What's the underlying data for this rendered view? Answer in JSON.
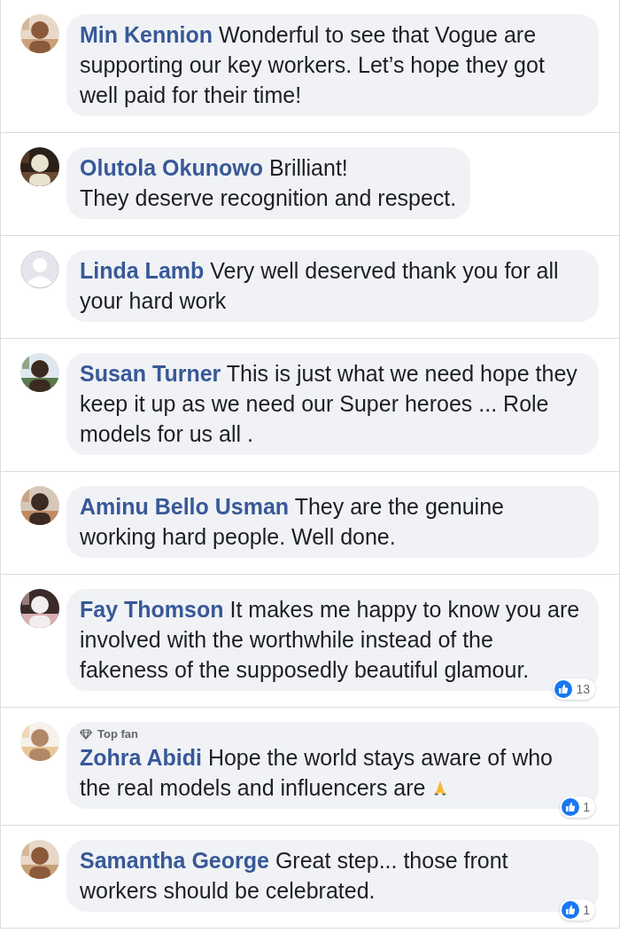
{
  "comments": [
    {
      "author": "Min Kennion",
      "text": "Wonderful to see that Vogue are supporting our key workers. Let’s hope they got well paid for their time!"
    },
    {
      "author": "Olutola Okunowo",
      "text": "Brilliant!\nThey deserve recognition and respect."
    },
    {
      "author": "Linda Lamb",
      "text": "Very well deserved thank you for all your hard work",
      "avatar": {
        "kind": "placeholder"
      }
    },
    {
      "author": "Susan Turner",
      "text": "This is just what we need hope they keep it up as we need our Super heroes ... Role models for us all ."
    },
    {
      "author": "Aminu Bello Usman",
      "text": "They are the genuine working hard people. Well done."
    },
    {
      "author": "Fay Thomson",
      "text": "It makes me happy to know you are involved with the worthwhile instead of the fakeness of the supposedly beautiful glamour.",
      "reactions": "13"
    },
    {
      "author": "Zohra Abidi",
      "text": "Hope the world stays aware of who the real models and influencers are",
      "top_fan": "Top fan",
      "ends_with_emoji": true,
      "reactions": "1"
    },
    {
      "author": "Samantha George",
      "text": "Great step... those front workers should be celebrated.",
      "reactions": "1"
    }
  ]
}
